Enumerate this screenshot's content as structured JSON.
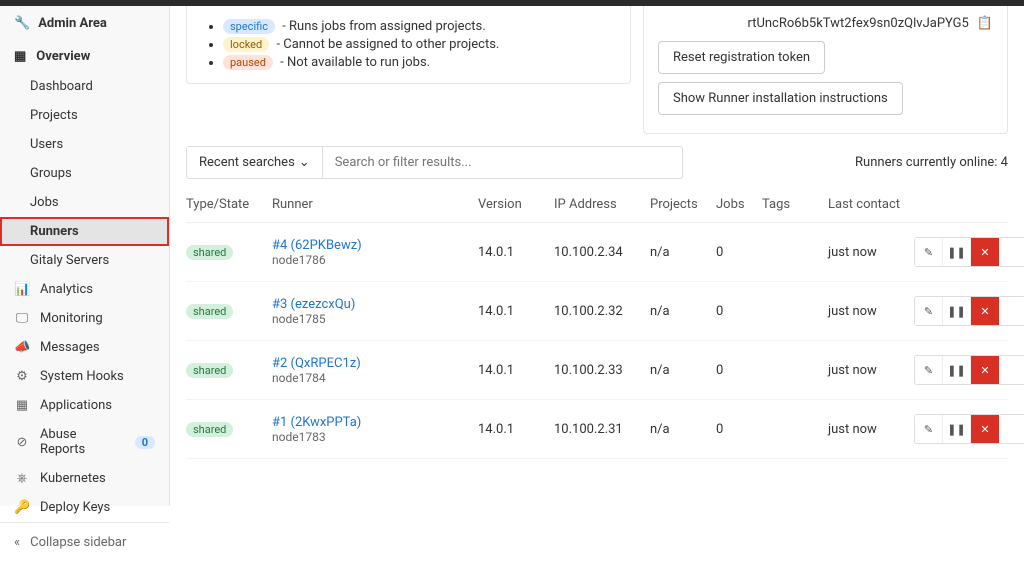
{
  "header": {
    "title": "Admin Area"
  },
  "sidebar": {
    "overview": "Overview",
    "items": [
      "Dashboard",
      "Projects",
      "Users",
      "Groups",
      "Jobs",
      "Runners",
      "Gitaly Servers"
    ],
    "active": 5,
    "bottom": [
      {
        "icon": "📊",
        "label": "Analytics"
      },
      {
        "icon": "🖵",
        "label": "Monitoring"
      },
      {
        "icon": "📣",
        "label": "Messages"
      },
      {
        "icon": "⚙",
        "label": "System Hooks"
      },
      {
        "icon": "▦",
        "label": "Applications"
      },
      {
        "icon": "⊘",
        "label": "Abuse Reports",
        "badge": "0"
      },
      {
        "icon": "⎈",
        "label": "Kubernetes"
      },
      {
        "icon": "🔑",
        "label": "Deploy Keys"
      }
    ],
    "collapse": "Collapse sidebar"
  },
  "legend": [
    {
      "tag": "specific",
      "cls": "specific",
      "desc": " - Runs jobs from assigned projects."
    },
    {
      "tag": "locked",
      "cls": "locked",
      "desc": " - Cannot be assigned to other projects."
    },
    {
      "tag": "paused",
      "cls": "paused",
      "desc": " - Not available to run jobs."
    }
  ],
  "token_panel": {
    "token": "rtUncRo6b5kTwt2fex9sn0zQlvJaPYG5",
    "reset": "Reset registration token",
    "show": "Show Runner installation instructions"
  },
  "toolbar": {
    "recent": "Recent searches",
    "search_placeholder": "Search or filter results...",
    "online": "Runners currently online: 4"
  },
  "columns": [
    "Type/State",
    "Runner",
    "Version",
    "IP Address",
    "Projects",
    "Jobs",
    "Tags",
    "Last contact"
  ],
  "runners": [
    {
      "state": "shared",
      "link": "#4 (62PKBewz)",
      "node": "node1786",
      "version": "14.0.1",
      "ip": "10.100.2.34",
      "projects": "n/a",
      "jobs": "0",
      "tags": "",
      "last": "just now"
    },
    {
      "state": "shared",
      "link": "#3 (ezezcxQu)",
      "node": "node1785",
      "version": "14.0.1",
      "ip": "10.100.2.32",
      "projects": "n/a",
      "jobs": "0",
      "tags": "",
      "last": "just now"
    },
    {
      "state": "shared",
      "link": "#2 (QxRPEC1z)",
      "node": "node1784",
      "version": "14.0.1",
      "ip": "10.100.2.33",
      "projects": "n/a",
      "jobs": "0",
      "tags": "",
      "last": "just now"
    },
    {
      "state": "shared",
      "link": "#1 (2KwxPPTa)",
      "node": "node1783",
      "version": "14.0.1",
      "ip": "10.100.2.31",
      "projects": "n/a",
      "jobs": "0",
      "tags": "",
      "last": "just now"
    }
  ]
}
